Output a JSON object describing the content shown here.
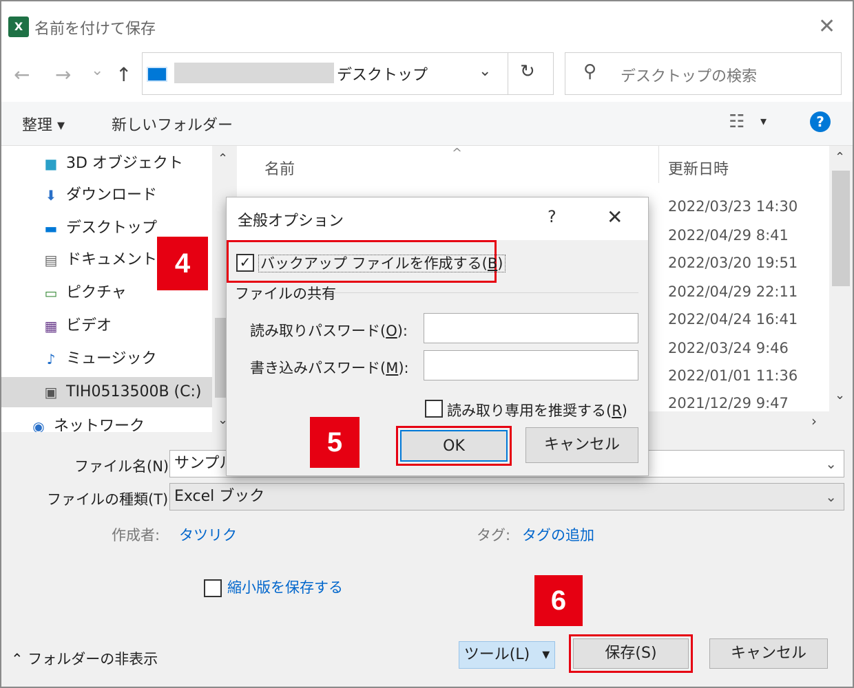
{
  "window": {
    "title": "名前を付けて保存",
    "app_icon_letter": "X"
  },
  "nav": {
    "back": "←",
    "forward": "→",
    "recent": "⌄",
    "up": "↑",
    "address_location": "デスクトップ",
    "address_dropdown": "⌄",
    "refresh": "↻",
    "search_placeholder": "デスクトップの検索"
  },
  "toolbar": {
    "organize": "整理 ▾",
    "new_folder": "新しいフォルダー",
    "view_dropdown": "▾",
    "help": "?"
  },
  "sidebar": {
    "items": [
      {
        "label": "3D オブジェクト",
        "icon": "cube-icon"
      },
      {
        "label": "ダウンロード",
        "icon": "download-icon"
      },
      {
        "label": "デスクトップ",
        "icon": "desktop-icon"
      },
      {
        "label": "ドキュメント",
        "icon": "document-icon"
      },
      {
        "label": "ピクチャ",
        "icon": "picture-icon"
      },
      {
        "label": "ビデオ",
        "icon": "video-icon"
      },
      {
        "label": "ミュージック",
        "icon": "music-icon"
      },
      {
        "label": "TIH0513500B (C:)",
        "icon": "drive-icon"
      },
      {
        "label": "ネットワーク",
        "icon": "network-icon"
      }
    ]
  },
  "filelist": {
    "col_name": "名前",
    "col_date": "更新日時",
    "dates": [
      "2022/03/23 14:30",
      "2022/04/29 8:41",
      "2022/03/20 19:51",
      "2022/04/29 22:11",
      "2022/04/24 16:41",
      "2022/03/24 9:46",
      "2022/01/01 11:36",
      "2021/12/29 9:47"
    ]
  },
  "form": {
    "filename_label": "ファイル名(N):",
    "filename_value": "サンプル",
    "filetype_label": "ファイルの種類(T):",
    "filetype_value": "Excel ブック",
    "author_label": "作成者:",
    "author_value": "タツリク",
    "tags_label": "タグ:",
    "tags_value": "タグの追加",
    "thumbnail_label": "縮小版を保存する"
  },
  "footer": {
    "hide_folders": "フォルダーの非表示",
    "tools": "ツール(L)",
    "save": "保存(S)",
    "cancel": "キャンセル"
  },
  "dialog": {
    "title": "全般オプション",
    "help": "?",
    "backup_pre": "バックアップ ファイルを作成する(",
    "backup_key": "B",
    "backup_post": ")",
    "backup_checked": true,
    "share_group": "ファイルの共有",
    "read_pw_pre": "読み取りパスワード(",
    "read_pw_key": "O",
    "read_pw_post": "):",
    "write_pw_pre": "書き込みパスワード(",
    "write_pw_key": "M",
    "write_pw_post": "):",
    "readonly_pre": "読み取り専用を推奨する(",
    "readonly_key": "R",
    "readonly_post": ")",
    "ok": "OK",
    "cancel": "キャンセル"
  },
  "callouts": {
    "step4": "4",
    "step5": "5",
    "step6": "6"
  },
  "colors": {
    "callout_red": "#e60012",
    "accent_blue": "#0078d7",
    "link_blue": "#0066cc"
  }
}
